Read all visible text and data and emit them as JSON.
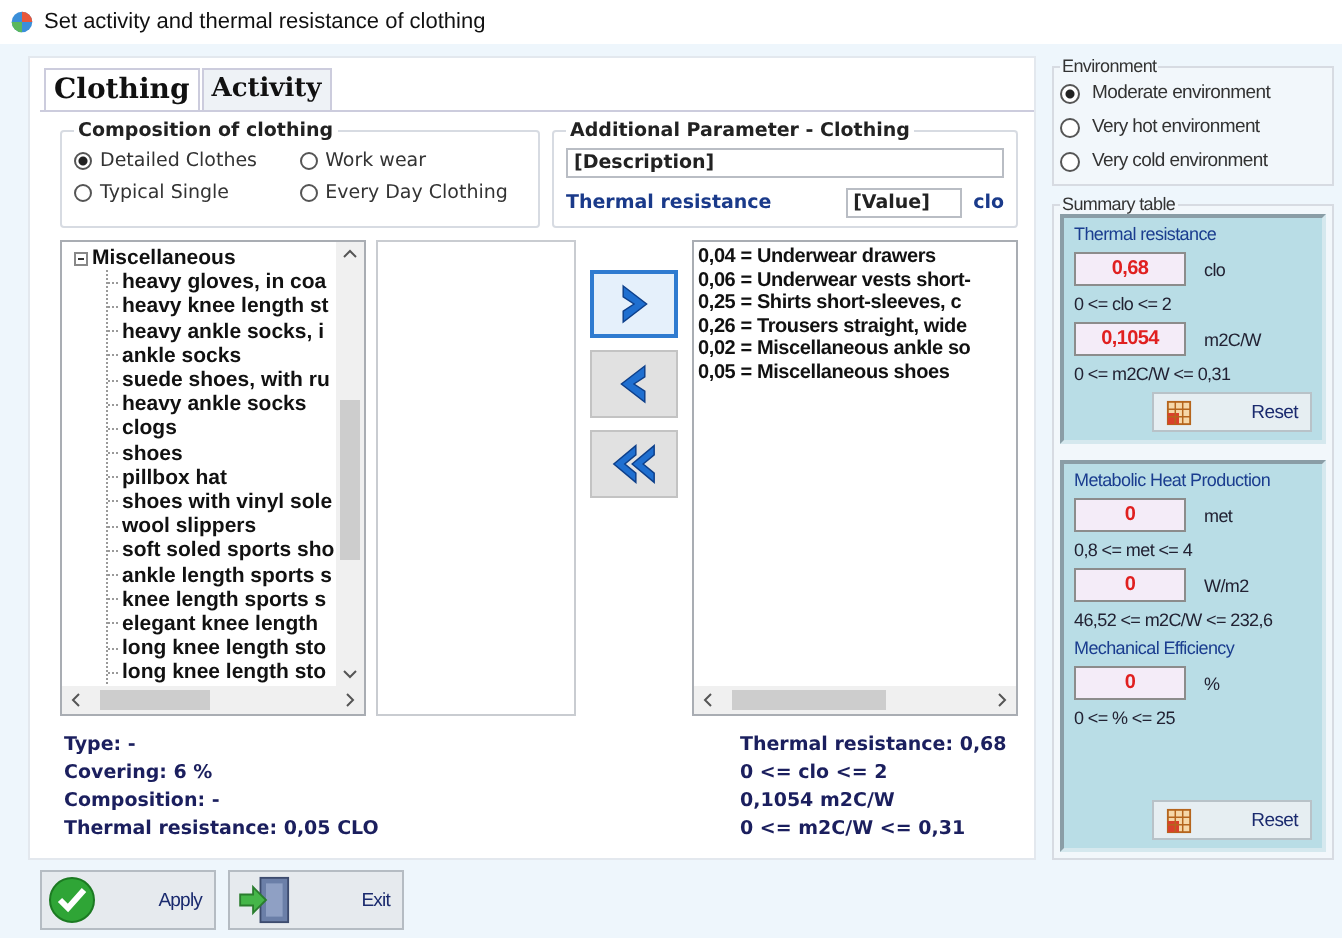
{
  "window": {
    "title": "Set activity and thermal resistance of clothing"
  },
  "tabs": [
    {
      "label": "Clothing",
      "selected": true
    },
    {
      "label": "Activity",
      "selected": false
    }
  ],
  "composition": {
    "title": "Composition of clothing",
    "options": [
      {
        "label": "Detailed Clothes",
        "selected": true
      },
      {
        "label": "Work wear",
        "selected": false
      },
      {
        "label": "Typical Single",
        "selected": false
      },
      {
        "label": "Every Day Clothing",
        "selected": false
      }
    ]
  },
  "additional": {
    "title": "Additional Parameter - Clothing",
    "description": "[Description]",
    "resistance_label": "Thermal resistance",
    "value": "[Value]",
    "unit": "clo"
  },
  "tree": [
    {
      "label": "Miscellaneous",
      "expanded": true,
      "children": [
        {
          "label": "heavy gloves, in coa"
        },
        {
          "label": "heavy knee length st"
        },
        {
          "label": "heavy ankle socks, i"
        },
        {
          "label": "ankle socks"
        },
        {
          "label": "suede shoes, with ru"
        },
        {
          "label": "heavy ankle socks"
        },
        {
          "label": "clogs"
        },
        {
          "label": "shoes"
        },
        {
          "label": "pillbox hat"
        },
        {
          "label": "shoes with vinyl sole"
        },
        {
          "label": "wool slippers"
        },
        {
          "label": "soft soled sports sho"
        },
        {
          "label": "ankle length sports s"
        },
        {
          "label": "knee length sports s"
        },
        {
          "label": "elegant knee length"
        },
        {
          "label": "long knee length sto"
        },
        {
          "label": "long knee length sto"
        }
      ]
    }
  ],
  "transfer_buttons": [
    {
      "kind": "add",
      "focused": true
    },
    {
      "kind": "remove",
      "focused": false
    },
    {
      "kind": "remove_all",
      "focused": false
    }
  ],
  "selected_items": [
    "0,04 = Underwear drawers",
    "0,06 = Underwear vests short-",
    "0,25 = Shirts short-sleeves, c",
    "0,26 = Trousers straight, wide",
    "0,02 = Miscellaneous ankle so",
    "0,05 = Miscellaneous shoes"
  ],
  "clothing_info": [
    "Type: -",
    "Covering: 6 %",
    "Composition: -",
    "Thermal resistance: 0,05 CLO"
  ],
  "totals": [
    "Thermal resistance: 0,68",
    "0 <= clo <= 2",
    "0,1054 m2C/W",
    "0 <= m2C/W <= 0,31"
  ],
  "environment": {
    "title": "Environment",
    "options": [
      {
        "label": "Moderate environment",
        "selected": true
      },
      {
        "label": "Very hot environment",
        "selected": false
      },
      {
        "label": "Very cold environment",
        "selected": false
      }
    ]
  },
  "summary": {
    "title": "Summary table",
    "boxes": [
      {
        "groups": [
          {
            "title": "Thermal resistance",
            "rows": [
              {
                "value": "0,68",
                "unit": "clo",
                "range": "0 <= clo <= 2"
              },
              {
                "value": "0,1054",
                "unit": "m2C/W",
                "range": "0 <= m2C/W <= 0,31"
              }
            ]
          }
        ],
        "reset": "Reset"
      },
      {
        "groups": [
          {
            "title": "Metabolic Heat Production",
            "rows": [
              {
                "value": "0",
                "unit": "met",
                "range": "0,8 <= met <= 4"
              },
              {
                "value": "0",
                "unit": "W/m2",
                "range": "46,52 <= m2C/W <= 232,6"
              }
            ]
          },
          {
            "title": "Mechanical Efficiency",
            "rows": [
              {
                "value": "0",
                "unit": "%",
                "range": "0 <= % <= 25"
              }
            ]
          }
        ],
        "reset": "Reset"
      }
    ]
  },
  "buttons": [
    {
      "kind": "apply",
      "label": "Apply"
    },
    {
      "kind": "exit",
      "label": "Exit"
    }
  ]
}
